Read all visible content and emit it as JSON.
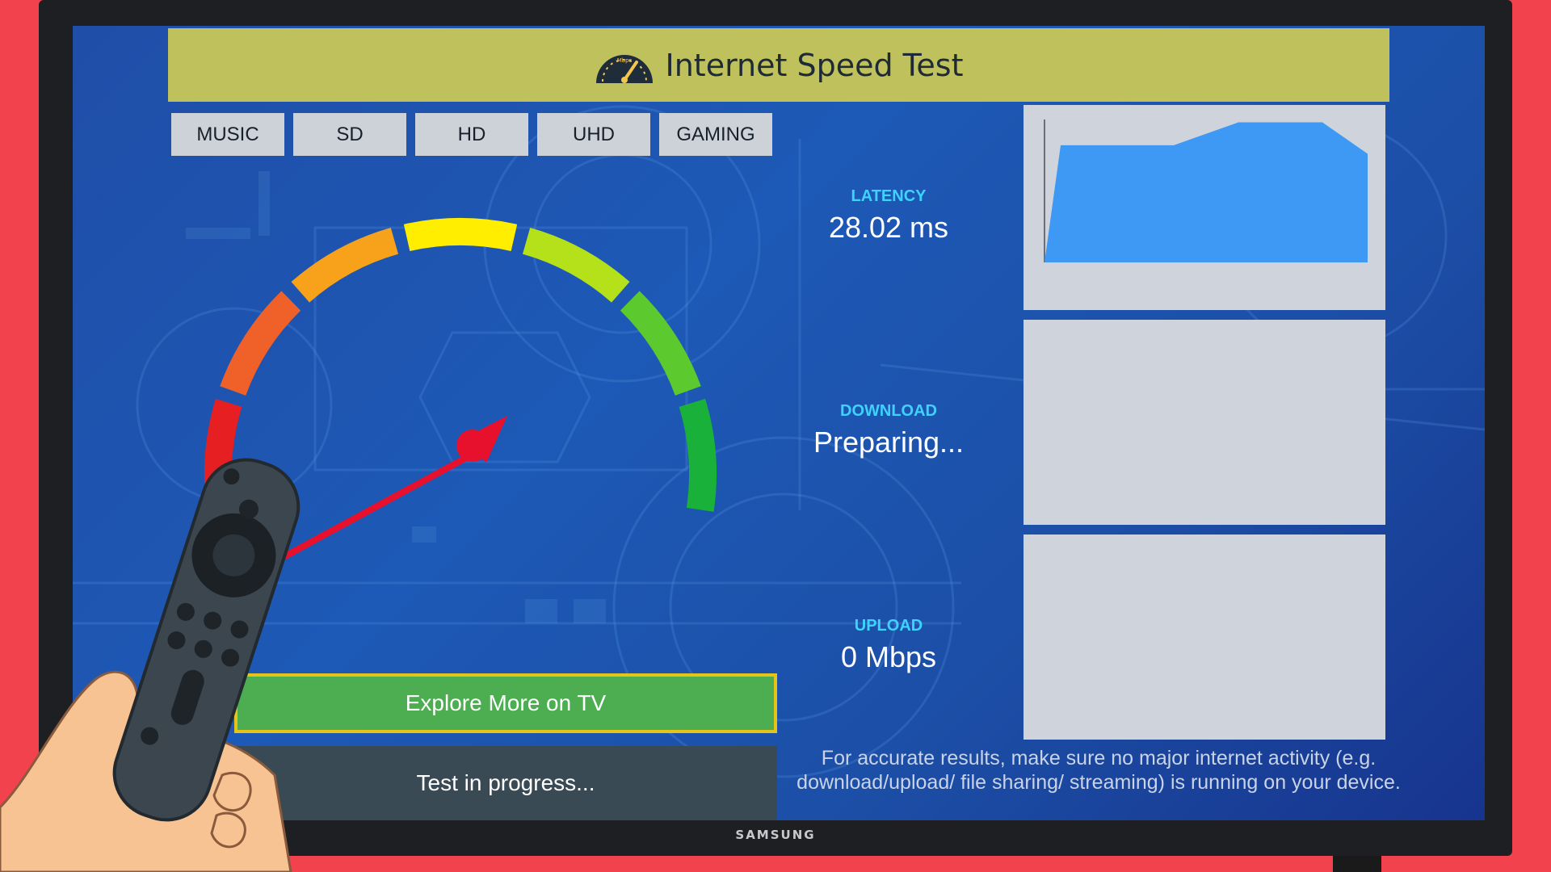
{
  "app": {
    "title": "Internet Speed Test",
    "icon": "speedometer-icon",
    "icon_text": "Mbps"
  },
  "tv": {
    "brand": "SAMSUNG"
  },
  "tabs": [
    {
      "label": "MUSIC"
    },
    {
      "label": "SD"
    },
    {
      "label": "HD"
    },
    {
      "label": "UHD"
    },
    {
      "label": "GAMING"
    }
  ],
  "gauge": {
    "segment_colors": [
      "#e51f22",
      "#f0612a",
      "#f7a21a",
      "#ffee00",
      "#b5e11a",
      "#5cc92e",
      "#1ab13a"
    ],
    "needle_color": "#e8112d"
  },
  "metrics": {
    "latency": {
      "label": "LATENCY",
      "value": "28.02 ms"
    },
    "download": {
      "label": "DOWNLOAD",
      "value": "Preparing..."
    },
    "upload": {
      "label": "UPLOAD",
      "value": "0 Mbps"
    }
  },
  "latency_graph": {
    "fill_color": "#3d99f4",
    "points": [
      [
        0,
        0
      ],
      [
        0.05,
        0.82
      ],
      [
        0.4,
        0.82
      ],
      [
        0.6,
        0.98
      ],
      [
        0.86,
        0.98
      ],
      [
        1,
        0.76
      ],
      [
        1,
        0
      ]
    ]
  },
  "explore_button": {
    "label": "Explore More on TV"
  },
  "status": {
    "text": "Test in progress..."
  },
  "notice": {
    "text": "For accurate results, make sure no major internet activity (e.g. download/upload/ file sharing/ streaming) is running on your device."
  },
  "colors": {
    "header_bg": "#bfc15c",
    "screen_bg": "#1d55b0",
    "panel_bg": "#cfd3dc",
    "accent_cyan": "#3fd2ff",
    "button_green": "#4cae50",
    "button_border": "#e6c319",
    "status_bg": "#394a55",
    "frame_red": "#f2424e"
  }
}
